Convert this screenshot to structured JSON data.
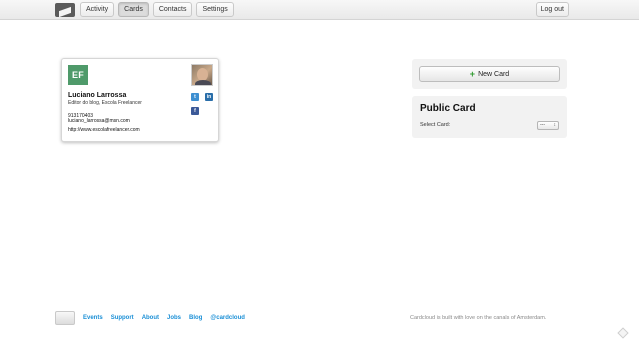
{
  "nav": {
    "items": [
      {
        "label": "Activity"
      },
      {
        "label": "Cards"
      },
      {
        "label": "Contacts"
      },
      {
        "label": "Settings"
      }
    ],
    "active": "Cards",
    "logout_label": "Log out"
  },
  "card": {
    "logo_text": "EF",
    "name": "Luciano Larrossa",
    "title": "Editor do blog, Escola Freelancer",
    "phone": "913170403",
    "email": "luciano_larrossa@msn.com",
    "url": "http://www.escolafreelancer.com",
    "social": {
      "twitter": "t",
      "linkedin": "in",
      "facebook": "f"
    },
    "colors": {
      "logo": "#4f9a6a"
    }
  },
  "sidebar": {
    "new_card_label": "New Card",
    "public_card_title": "Public Card",
    "select_label": "Select Card:",
    "select_value": "---"
  },
  "footer": {
    "links": [
      {
        "label": "Events"
      },
      {
        "label": "Support"
      },
      {
        "label": "About"
      },
      {
        "label": "Jobs"
      },
      {
        "label": "Blog"
      },
      {
        "label": "@cardcloud"
      }
    ],
    "note": "Cardcloud is built with love on the canals of Amsterdam.",
    "link_color": "#1a8fd6"
  }
}
